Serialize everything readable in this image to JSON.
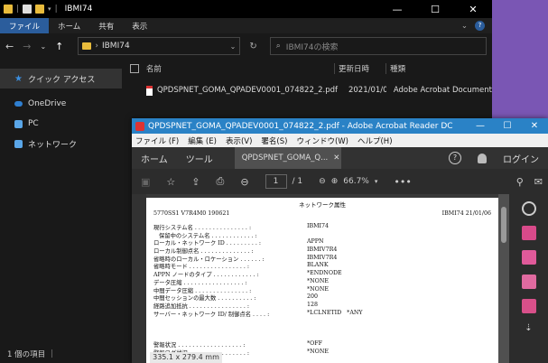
{
  "explorer": {
    "title": "IBMI74",
    "ribbon_tabs": [
      "ファイル",
      "ホーム",
      "共有",
      "表示"
    ],
    "address_path": "IBMI74",
    "search_placeholder": "IBMI74の検索",
    "nav_items": [
      "クイック アクセス",
      "OneDrive",
      "PC",
      "ネットワーク"
    ],
    "columns": {
      "name": "名前",
      "date": "更新日時",
      "type": "種類"
    },
    "file": {
      "name": "QPDSPNET_GOMA_QPADEV0001_074822_2.pdf",
      "date": "2021/01/06 ...",
      "type": "Adobe Acrobat Document"
    },
    "status": "1 個の項目",
    "status_sep": "|"
  },
  "acrobat": {
    "title": "QPDSPNET_GOMA_QPADEV0001_074822_2.pdf - Adobe Acrobat Reader DC",
    "menu": [
      "ファイル (F)",
      "編集 (E)",
      "表示(V)",
      "署名(S)",
      "ウィンドウ(W)",
      "ヘルプ(H)"
    ],
    "tabs": {
      "home": "ホーム",
      "tools": "ツール",
      "doc": "QPDSPNET_GOMA_Q..."
    },
    "login": "ログイン",
    "help_glyph": "?",
    "page_current": "1",
    "page_total": "/ 1",
    "zoom": "66.7%",
    "more": "•••",
    "page_size": "335.1 x 279.4 mm",
    "page": {
      "title": "ネットワーク属性",
      "header_left": "5770SS1 V7R4M0  190621",
      "header_right": "IBMI74    21/01/06",
      "lines": [
        {
          "k": "現行システム名 . . . . . . . . . . . . . . . :",
          "v": "IBMI74"
        },
        {
          "k": "   保留中のシステム名 . . . . . . . . . . . . :",
          "v": ""
        },
        {
          "k": "ローカル・ネットワーク ID . . . . . . . . . :",
          "v": "APPN"
        },
        {
          "k": "ローカル制御点名 . . . . . . . . . . . . . . :",
          "v": "IBMIV7R4"
        },
        {
          "k": "省略時のローカル・ロケーション . . . . . . :",
          "v": "IBMIV7R4"
        },
        {
          "k": "省略時モード . . . . . . . . . . . . . . . . :",
          "v": "BLANK"
        },
        {
          "k": "APPN ノードのタイプ . . . . . . . . . . . . :",
          "v": "*ENDNODE"
        },
        {
          "k": "データ圧縮 . . . . . . . . . . . . . . . . . :",
          "v": "*NONE"
        },
        {
          "k": "中間データ圧縮 . . . . . . . . . . . . . . . :",
          "v": "*NONE"
        },
        {
          "k": "中間セッションの最大数 . . . . . . . . . . :",
          "v": "200"
        },
        {
          "k": "経路追加抵抗 . . . . . . . . . . . . . . . . :",
          "v": "128"
        },
        {
          "k": "サーバー・ネットワーク ID/ 制御点名 . . . . :",
          "v": "*LCLNETID   *ANY"
        }
      ],
      "lines2": [
        {
          "k": "警報状況 . . . . . . . . . . . . . . . . . . :",
          "v": "*OFF"
        },
        {
          "k": "警報ログ状況 . . . . . . . . . . . . . . . . :",
          "v": "*NONE"
        }
      ]
    }
  },
  "colors": {
    "explorer_bg": "#191919",
    "acrobat_title": "#2a82c6",
    "desktop": "#7a56b4",
    "ribbon_active": "#2b5d9c"
  }
}
